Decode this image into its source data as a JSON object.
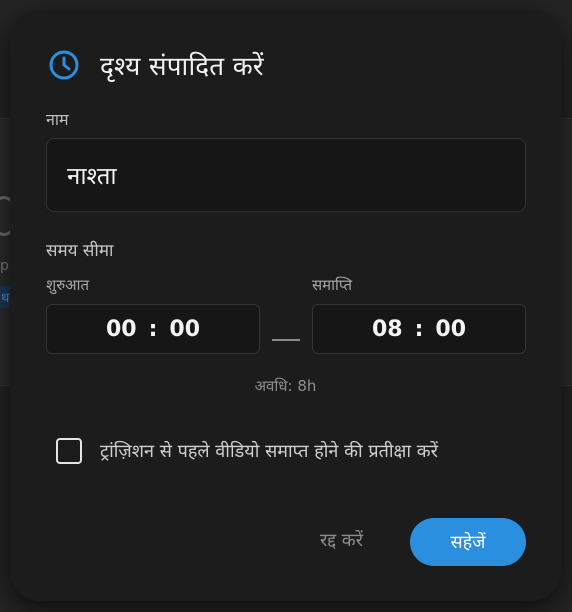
{
  "background": {
    "partial_text_1": "p",
    "partial_text_2": "थ"
  },
  "dialog": {
    "title": "दृश्य संपादित करें",
    "icon": "clock-icon",
    "accent_color": "#2b8fe0",
    "name_label": "नाम",
    "name_value": "नाश्ता",
    "time_range_label": "समय सीमा",
    "start_label": "शुरुआत",
    "start_hours": "00",
    "start_minutes": "00",
    "end_label": "समाप्ति",
    "end_hours": "08",
    "end_minutes": "00",
    "time_separator": ":",
    "dash": "—",
    "duration_text": "अवधि: 8h",
    "checkbox_checked": false,
    "checkbox_label": "ट्रांज़िशन से पहले वीडियो समाप्त होने की प्रतीक्षा करें",
    "cancel_label": "रद्द करें",
    "save_label": "सहेजें"
  }
}
